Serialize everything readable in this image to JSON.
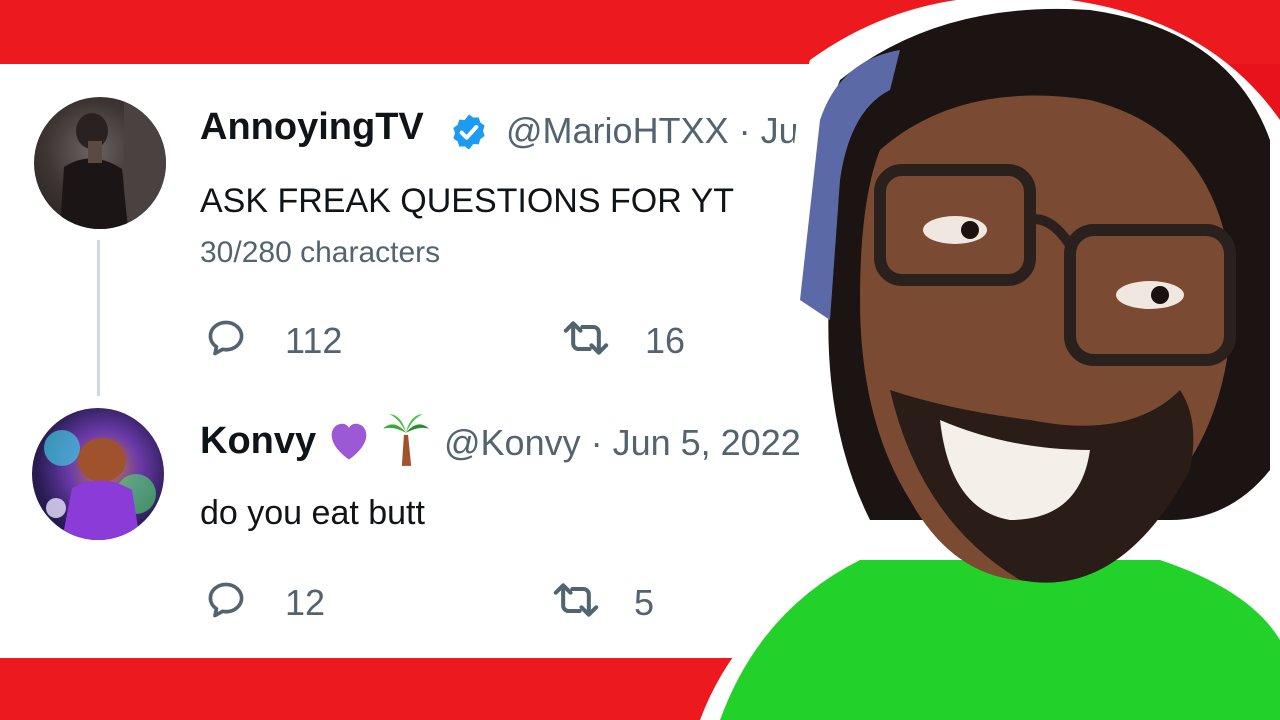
{
  "tweets": [
    {
      "name": "AnnoyingTV",
      "handle": "@MarioHTXX · Ju",
      "text": "ASK FREAK QUESTIONS FOR YT",
      "meta": "30/280 characters",
      "replies": "112",
      "retweets": "16",
      "verified": true
    },
    {
      "name": "Konvy",
      "handle": "@Konvy · Jun 5, 2022",
      "text": "do you eat butt",
      "replies": "12",
      "retweets": "5",
      "emojis": [
        "purple-heart",
        "palm-tree"
      ]
    }
  ],
  "colors": {
    "accent_red": "#ec1a1f",
    "verified_blue": "#1d9bf0",
    "muted": "#536471",
    "text": "#0f1419",
    "shirt_green": "#22d12a"
  }
}
